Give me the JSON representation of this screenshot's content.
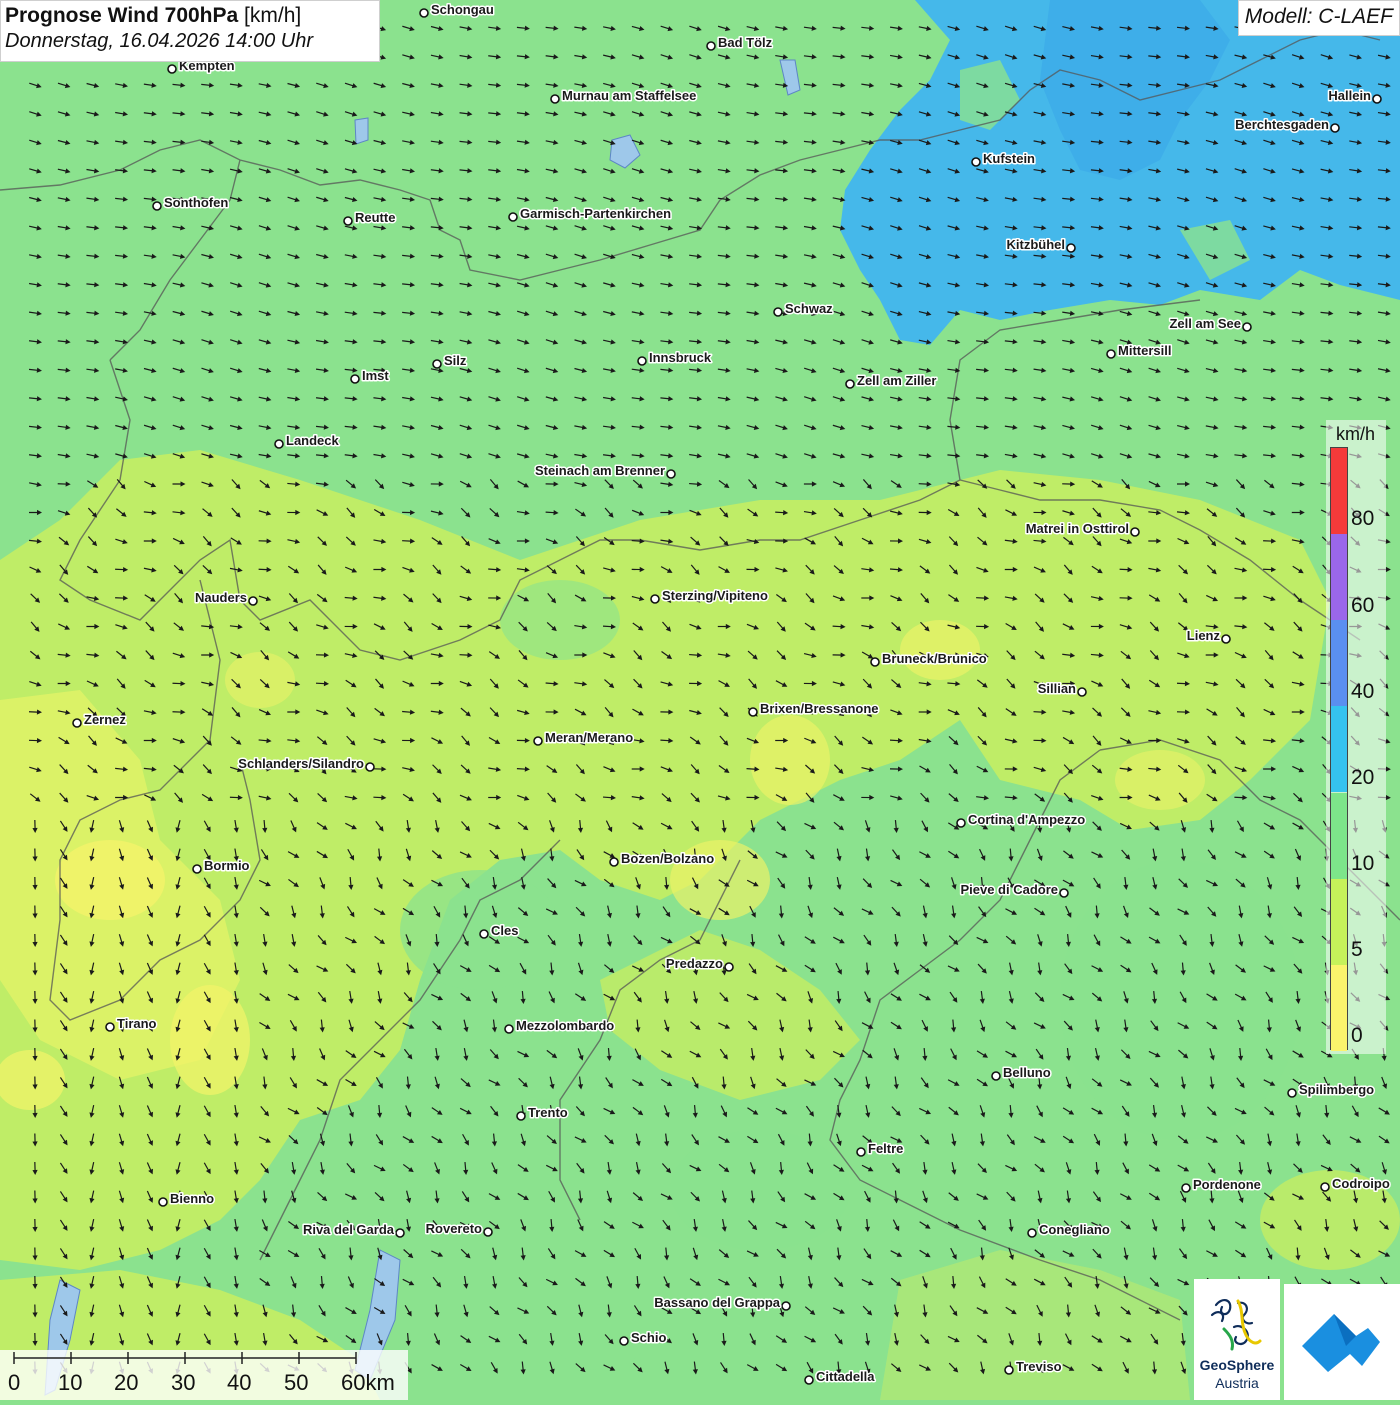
{
  "header": {
    "title_bold": "Prognose Wind 700hPa",
    "title_unit": "[km/h]",
    "datetime": "Donnerstag, 16.04.2026 14:00 Uhr",
    "model": "Modell: C-LAEF"
  },
  "legend": {
    "unit": "km/h",
    "ticks": [
      "80",
      "60",
      "40",
      "20",
      "10",
      "5",
      "0"
    ],
    "colors": [
      "#f53a3a",
      "#9a67ea",
      "#5a8ff0",
      "#35c3ef",
      "#7de58a",
      "#c6f25a",
      "#fbf46c"
    ]
  },
  "scale_bar": {
    "labels": [
      "0",
      "10",
      "20",
      "30",
      "40",
      "50",
      "60km"
    ]
  },
  "map": {
    "cities": [
      {
        "name": "Schongau"
      },
      {
        "name": "Bad Tölz"
      },
      {
        "name": "Kempten"
      },
      {
        "name": "Murnau am Staffelsee"
      },
      {
        "name": "Hallein"
      },
      {
        "name": "Berchtesgaden"
      },
      {
        "name": "Kufstein"
      },
      {
        "name": "Sonthofen"
      },
      {
        "name": "Reutte"
      },
      {
        "name": "Garmisch-Partenkirchen"
      },
      {
        "name": "Kitzbühel"
      },
      {
        "name": "Schwaz"
      },
      {
        "name": "Zell am See"
      },
      {
        "name": "Mittersill"
      },
      {
        "name": "Innsbruck"
      },
      {
        "name": "Silz"
      },
      {
        "name": "Imst"
      },
      {
        "name": "Zell am Ziller"
      },
      {
        "name": "Landeck"
      },
      {
        "name": "Steinach am Brenner"
      },
      {
        "name": "Matrei in Osttirol"
      },
      {
        "name": "Nauders"
      },
      {
        "name": "Sterzing/Vipiteno"
      },
      {
        "name": "Lienz"
      },
      {
        "name": "Bruneck/Brunico"
      },
      {
        "name": "Sillian"
      },
      {
        "name": "Brixen/Bressanone"
      },
      {
        "name": "Zernez"
      },
      {
        "name": "Meran/Merano"
      },
      {
        "name": "Schlanders/Silandro"
      },
      {
        "name": "Cortina d'Ampezzo"
      },
      {
        "name": "Bormio"
      },
      {
        "name": "Bozen/Bolzano"
      },
      {
        "name": "Pieve di Cadore"
      },
      {
        "name": "Cles"
      },
      {
        "name": "Predazzo"
      },
      {
        "name": "Tirano"
      },
      {
        "name": "Mezzolombardo"
      },
      {
        "name": "Belluno"
      },
      {
        "name": "Spilimbergo"
      },
      {
        "name": "Trento"
      },
      {
        "name": "Feltre"
      },
      {
        "name": "Pordenone"
      },
      {
        "name": "Codroipo"
      },
      {
        "name": "Bienno"
      },
      {
        "name": "Riva del Garda"
      },
      {
        "name": "Rovereto"
      },
      {
        "name": "Conegliano"
      },
      {
        "name": "Bassano del Grappa"
      },
      {
        "name": "Schio"
      },
      {
        "name": "Treviso"
      },
      {
        "name": "Cittadella"
      }
    ]
  },
  "logos": {
    "geosphere_line1": "GeoSphere",
    "geosphere_line2": "Austria",
    "geosphere_icon": "geosphere-logo-icon",
    "app_icon": "wetter-app-icon"
  }
}
